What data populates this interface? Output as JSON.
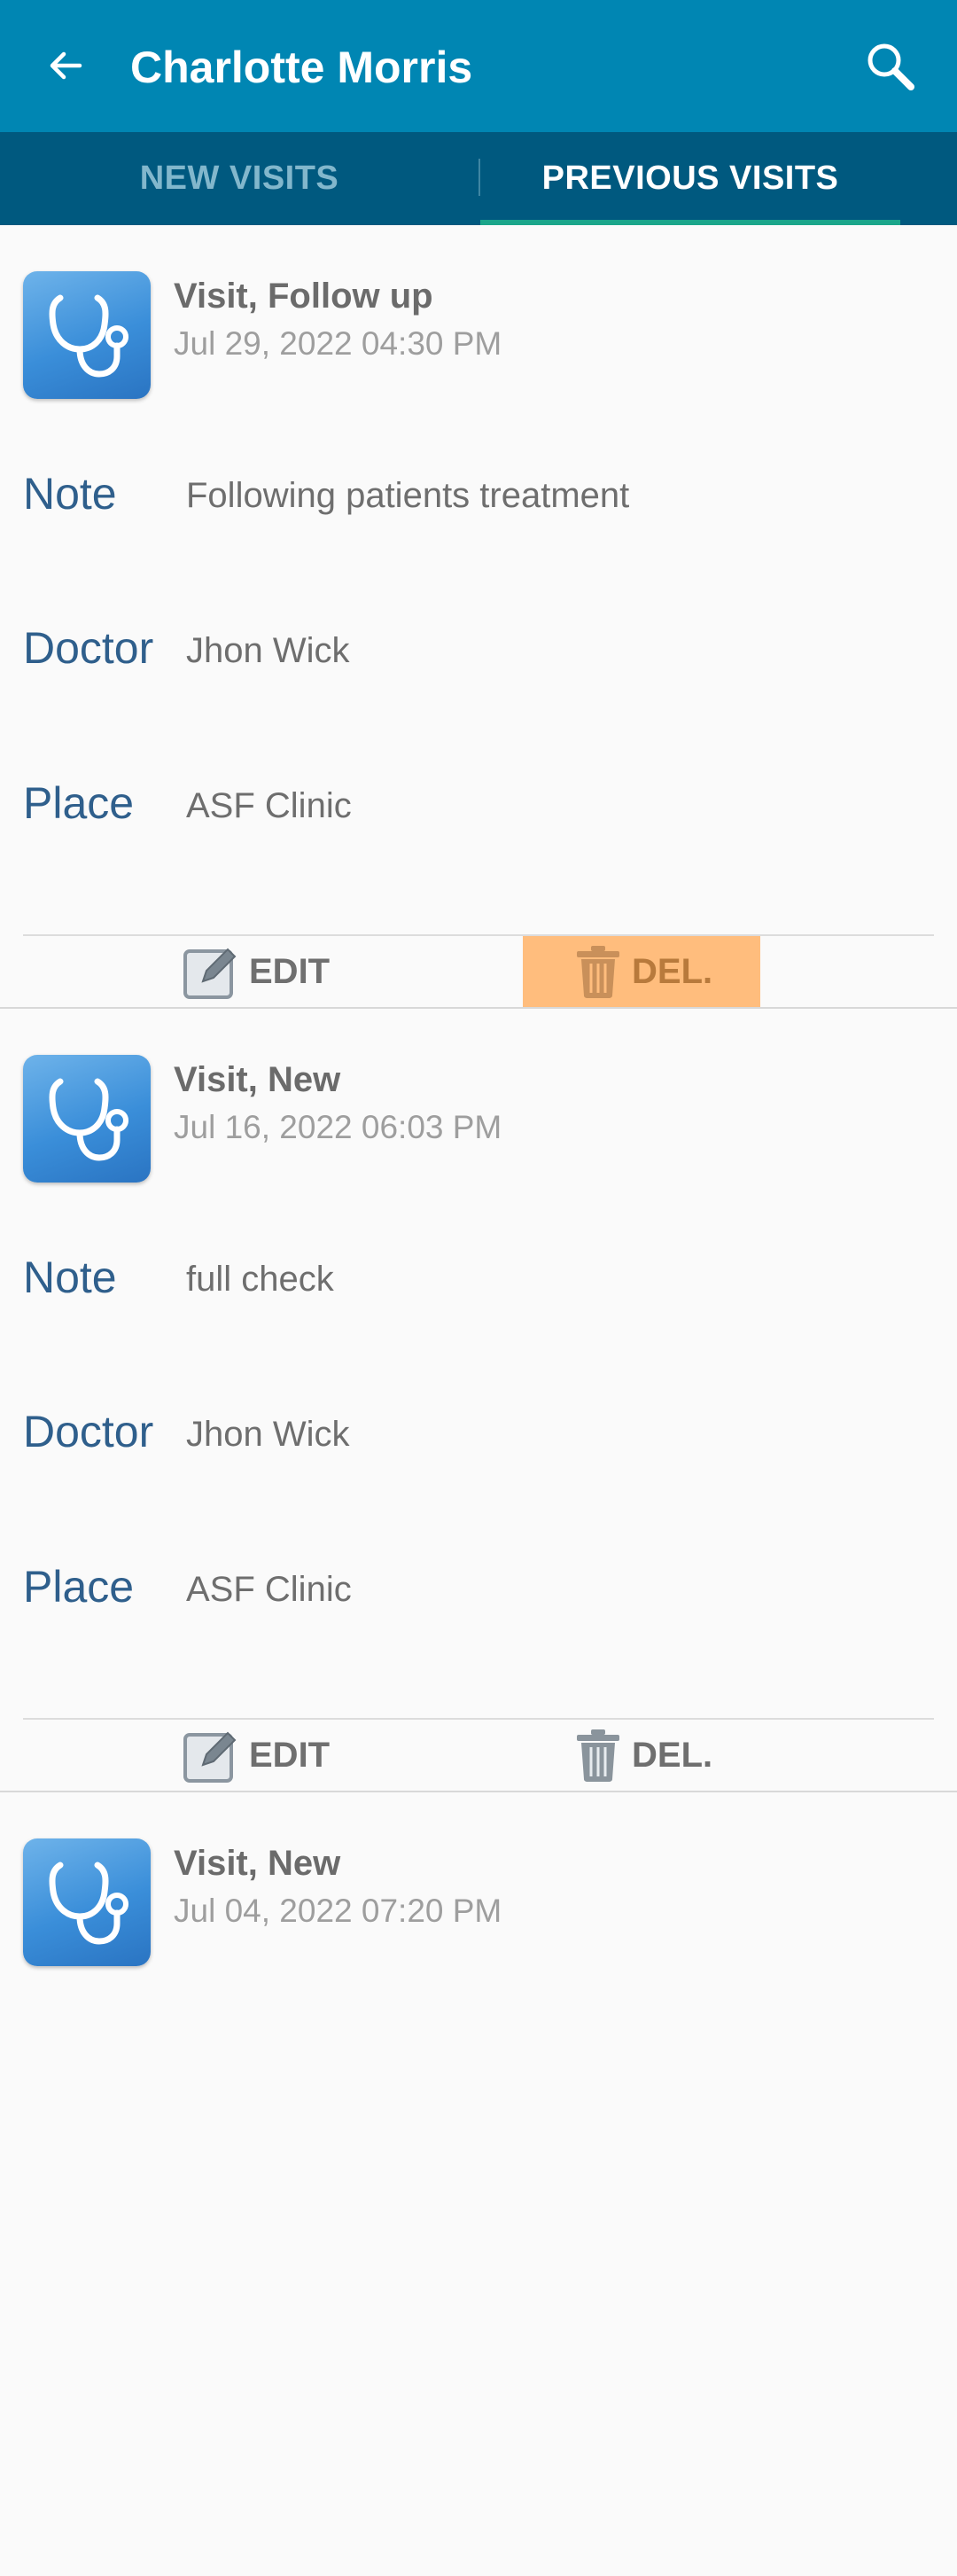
{
  "header": {
    "title": "Charlotte Morris",
    "back_icon": "arrow-left-icon",
    "search_icon": "search-icon"
  },
  "tabs": [
    {
      "label": "NEW VISITS",
      "selected": false
    },
    {
      "label": "PREVIOUS VISITS",
      "selected": true
    }
  ],
  "colors": {
    "appbar": "#0086b3",
    "tabbar": "#00597f",
    "indicator": "#1aa58a",
    "label": "#2f5f8c",
    "del_highlight": "#ffbd7d"
  },
  "labels": {
    "note": "Note",
    "doctor": "Doctor",
    "place": "Place",
    "edit": "EDIT",
    "delete": "DEL."
  },
  "visits": [
    {
      "title": "Visit, Follow up",
      "date": "Jul 29, 2022 04:30 PM",
      "note": "Following patients treatment",
      "doctor": "Jhon Wick",
      "place": "ASF Clinic",
      "delete_pressed": true
    },
    {
      "title": "Visit, New",
      "date": "Jul 16, 2022 06:03 PM",
      "note": "full check",
      "doctor": "Jhon Wick",
      "place": "ASF Clinic",
      "delete_pressed": false
    },
    {
      "title": "Visit, New",
      "date": "Jul 04, 2022 07:20 PM",
      "note": "",
      "doctor": "",
      "place": "",
      "delete_pressed": false
    }
  ]
}
